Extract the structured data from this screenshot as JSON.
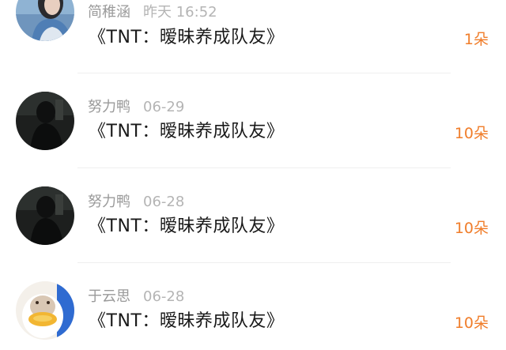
{
  "gift_records": [
    {
      "user": "简稚涵",
      "time": "昨天 16:52",
      "title": "《TNT：暧昧养成队友》",
      "gift": "1朵",
      "avatar": "avatar-photo-blue"
    },
    {
      "user": "努力鸭",
      "time": "06-29",
      "title": "《TNT：暧昧养成队友》",
      "gift": "10朵",
      "avatar": "avatar-photo-dark"
    },
    {
      "user": "努力鸭",
      "time": "06-28",
      "title": "《TNT：暧昧养成队友》",
      "gift": "10朵",
      "avatar": "avatar-photo-dark"
    },
    {
      "user": "于云思",
      "time": "06-28",
      "title": "《TNT：暧昧养成队友》",
      "gift": "10朵",
      "avatar": "avatar-cartoon-duck"
    }
  ],
  "colors": {
    "gift_accent": "#f07d2a",
    "meta_text": "#a6a6a6",
    "title_text": "#1a1a1a",
    "divider": "#efefef"
  }
}
